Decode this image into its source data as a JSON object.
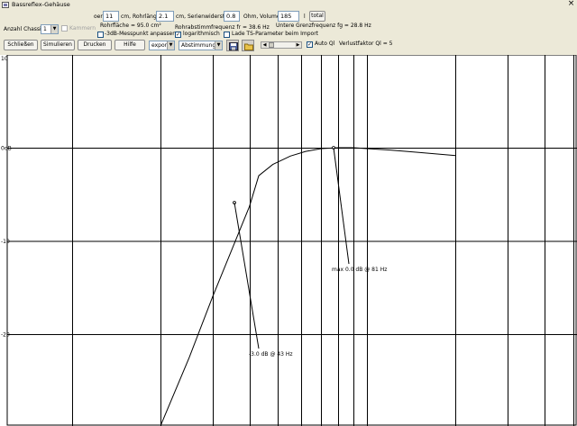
{
  "window": {
    "title": "Bassreflex-Gehäuse"
  },
  "toolbar": {
    "diameter_prefix": "oer",
    "diameter_value": "11",
    "diameter_unit": "cm, Rohrlänge",
    "tube_length_value": "2.1",
    "tube_length_unit": "cm, Serienwiderstand",
    "resistance_value": "0.8",
    "volume_label": "Ohm, Volumen",
    "volume_value": "185",
    "volume_unit": "l",
    "total_button": "total",
    "chassis_label": "Anzahl Chassis",
    "chassis_value": "1",
    "kammern_label": "Kammern",
    "tube_area_text": "Rohrfläche = 95.0 cm²",
    "resonance_text": "Rohrabstimmfrequenz fr = 38.6 Hz",
    "cutoff_text": "Untere Grenzfrequenz fg = 28.8 Hz",
    "adjust_3db_label": "-3dB-Messpunkt anpassen",
    "log_label": "logarithmisch",
    "ts_import_label": "Lade TS-Parameter beim Import",
    "close_button": "Schließen",
    "simulate_button": "Simulieren",
    "print_button": "Drucken",
    "help_button": "Hilfe",
    "export_value": "export",
    "tuning_value": "Abstimmung",
    "auto_ql_label": "Auto Ql",
    "loss_factor_text": "Verlustfaktor Ql = 5",
    "log_checked": true,
    "auto_ql_checked": true,
    "adjust_3db_checked": false,
    "ts_import_checked": false,
    "kammern_checked": false
  },
  "icons": {
    "app": "speaker-box-icon",
    "close": "close-icon",
    "save": "save-icon",
    "open": "open-folder-icon"
  },
  "chart_data": {
    "type": "line",
    "xscale": "log",
    "ylim": [
      -30,
      10
    ],
    "yticks": [
      "10",
      "0dB",
      "-10",
      "-20"
    ],
    "ytick_values": [
      10,
      0,
      -10,
      -20
    ],
    "series": [
      {
        "x": [
          20,
          25,
          30,
          35,
          40,
          43,
          48,
          55,
          62,
          70,
          80,
          81,
          90,
          100,
          120,
          150,
          200
        ],
        "y": [
          -29.8,
          -22.5,
          -16.0,
          -10.8,
          -6.3,
          -3.0,
          -1.8,
          -0.9,
          -0.4,
          -0.1,
          0.0,
          0.0,
          0.0,
          -0.1,
          -0.25,
          -0.5,
          -0.85
        ]
      }
    ],
    "annotations": [
      {
        "text": "-3.0 dB @ 43 Hz",
        "x": 43,
        "y": -3.0
      },
      {
        "text": "max 0.0 dB @ 81 Hz",
        "x": 81,
        "y": 0.0
      }
    ]
  },
  "colors": {
    "background": "#ece9d8",
    "plot_background": "#ffffff",
    "grid": "#000000",
    "curve": "#000000"
  }
}
